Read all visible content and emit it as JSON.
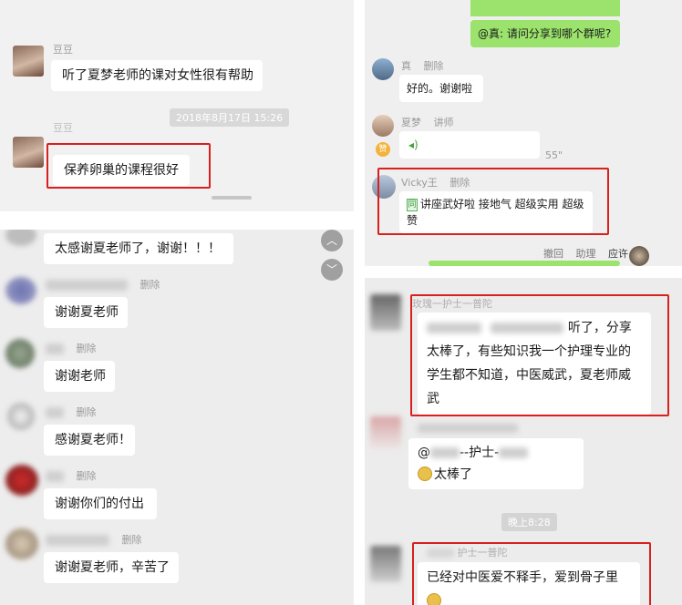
{
  "panel_a": {
    "msg1": {
      "name": "豆豆",
      "text": "听了夏梦老师的课对女性很有帮助"
    },
    "timestamp": "2018年8月17日 15:26",
    "msg2": {
      "name": "豆豆",
      "text": "保养卵巢的课程很好"
    }
  },
  "panel_b": {
    "delete_label": "删除",
    "msg0": {
      "text": "太感谢夏老师了，谢谢！！！"
    },
    "msg1": {
      "text": "谢谢夏老师"
    },
    "msg2": {
      "text": "谢谢老师"
    },
    "msg3": {
      "text": "感谢夏老师！"
    },
    "msg4": {
      "text": "谢谢你们的付出"
    },
    "msg5": {
      "text": "谢谢夏老师，辛苦了"
    },
    "scroll_up_icon": "chevron-up-icon",
    "scroll_down_icon": "chevron-down-icon"
  },
  "panel_c": {
    "green_text": "@真: 请问分享到哪个群呢?",
    "msg1": {
      "name": "真",
      "action": "删除",
      "text": "好的。谢谢啦"
    },
    "msg2": {
      "name": "夏梦",
      "role": "讲师",
      "badge": "赞",
      "voice_duration": "55\""
    },
    "msg3": {
      "name": "Vicky王",
      "action": "删除",
      "text": "讲座武好啦 接地气 超级实用 超级赞"
    },
    "bottom_actions": [
      "撤回",
      "助理",
      "应许"
    ]
  },
  "panel_d": {
    "msg1": {
      "name_fragment": "玫瑰一护士一普陀",
      "text": "听了，分享太棒了，有些知识我一个护理专业的学生都不知道，中医威武，夏老师威武"
    },
    "msg2": {
      "at": "@",
      "middle": "--护士-",
      "text": "太棒了"
    },
    "time": "晚上8:28",
    "msg3": {
      "name_fragment": "护士一普陀",
      "text": "已经对中医爱不释手，爱到骨子里"
    }
  },
  "colors": {
    "red_highlight": "#d8211f",
    "wechat_green": "#9be36c"
  }
}
